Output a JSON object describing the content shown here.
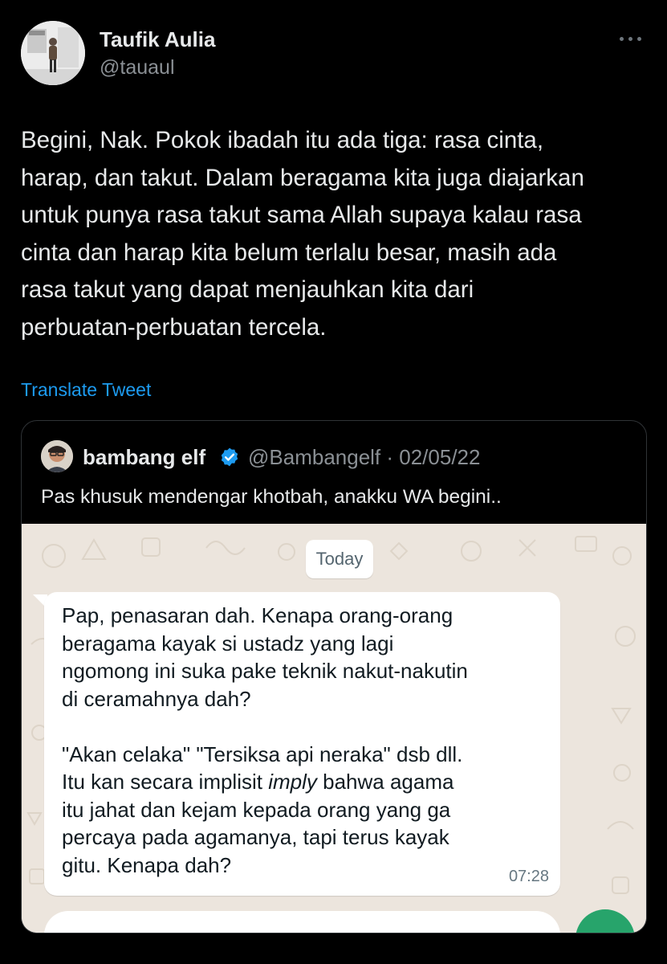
{
  "author": {
    "name": "Taufik Aulia",
    "handle": "@tauaul"
  },
  "tweet": {
    "text": "Begini, Nak. Pokok ibadah itu ada tiga: rasa cinta,\nharap, dan takut. Dalam beragama kita juga diajarkan\nuntuk punya rasa takut sama Allah supaya kalau rasa\ncinta dan harap kita belum terlalu besar, masih ada\nrasa takut yang dapat menjauhkan kita dari\nperbuatan-perbuatan tercela.",
    "translate_label": "Translate Tweet"
  },
  "quote": {
    "name": "bambang elf",
    "handle_date": "@Bambangelf · 02/05/22",
    "text": "Pas khusuk mendengar khotbah, anakku WA begini.."
  },
  "chat": {
    "date_label": "Today",
    "message": {
      "lines_a": [
        "Pap, penasaran dah. Kenapa orang-orang",
        "beragama kayak si ustadz yang lagi",
        "ngomong ini suka pake teknik nakut-nakutin",
        "di ceramahnya dah?"
      ],
      "line_b1": "\"Akan celaka\" \"Tersiksa api neraka\" dsb dll.",
      "line_b2_pre": "Itu kan secara implisit ",
      "line_b2_italic": "imply",
      "line_b2_post": " bahwa agama",
      "lines_c": [
        "itu jahat dan kejam kepada orang yang ga",
        "percaya pada agamanya, tapi terus kayak",
        "gitu. Kenapa dah?"
      ],
      "time": "07:28"
    }
  },
  "colors": {
    "background": "#000000",
    "text": "#e7e9ea",
    "secondary": "#8b9095",
    "link": "#1d9bf0",
    "verified": "#1d9bf0",
    "chat_bg": "#ece5dd",
    "whatsapp_green": "#27a46b"
  },
  "icons": [
    "more-icon",
    "verified-badge-icon",
    "avatar-photo",
    "quote-avatar-photo"
  ]
}
